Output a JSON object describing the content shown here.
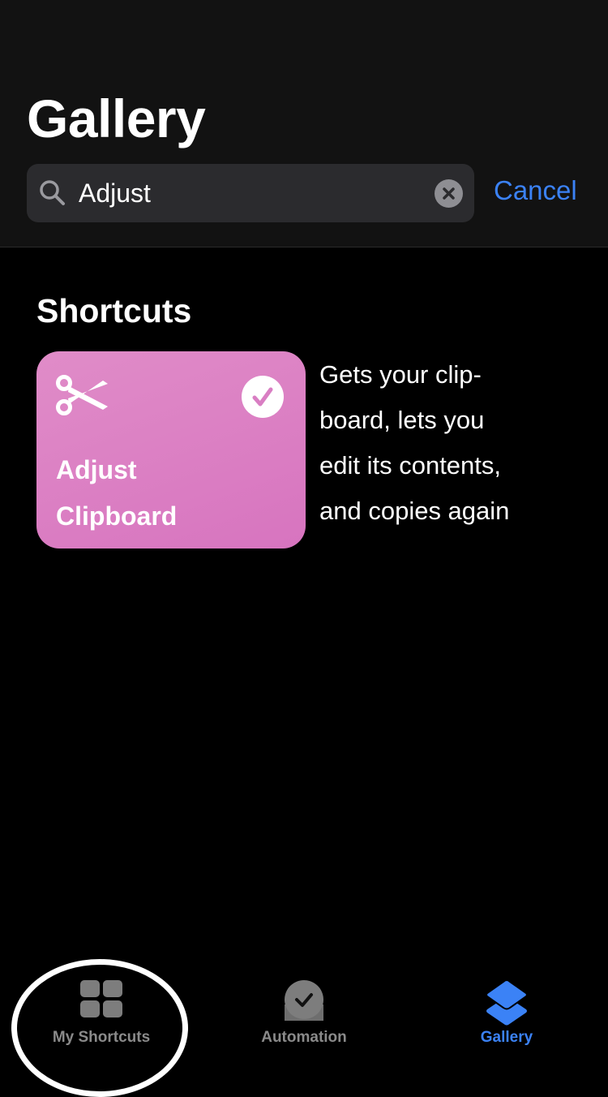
{
  "header": {
    "title": "Gallery",
    "cancel_label": "Cancel"
  },
  "search": {
    "value": "Adjust",
    "icon": "search-icon",
    "clear_icon": "clear-icon"
  },
  "section": {
    "title": "Shortcuts"
  },
  "shortcut": {
    "title_line1": "Adjust",
    "title_line2": "Clipboard",
    "icon": "scissors-icon",
    "color": "#dc82c5",
    "description_lines": [
      "Gets your clip-",
      "board, lets you",
      "edit its contents,",
      "and copies again"
    ]
  },
  "tabbar": {
    "tabs": [
      {
        "label": "My Shortcuts",
        "icon": "grid-icon",
        "active": false
      },
      {
        "label": "Automation",
        "icon": "clock-check-icon",
        "active": false
      },
      {
        "label": "Gallery",
        "icon": "layers-icon",
        "active": true
      }
    ],
    "accent": "#3b82f6"
  }
}
